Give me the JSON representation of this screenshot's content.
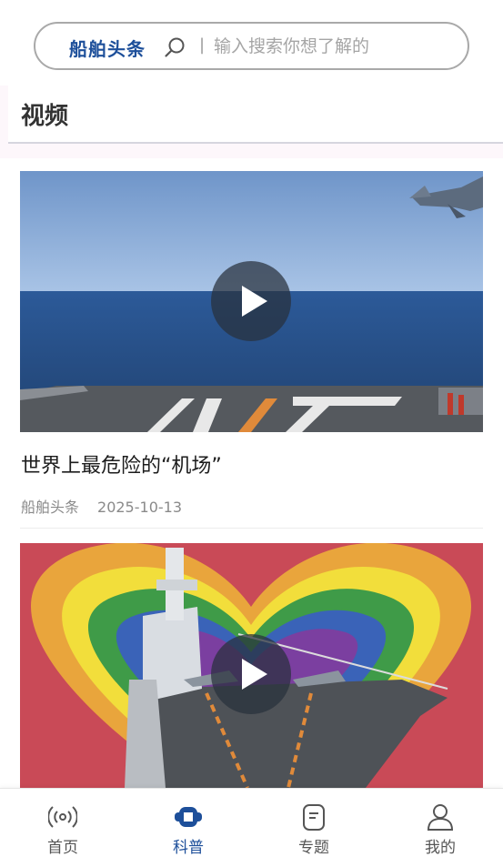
{
  "search": {
    "brand": "船舶头条",
    "separator": "|",
    "placeholder": "输入搜索你想了解的"
  },
  "section": {
    "title": "视频"
  },
  "videos": [
    {
      "title": "世界上最危险的“机场”",
      "source": "船舶头条",
      "date": "2025-10-13"
    },
    {
      "title": "",
      "source": "",
      "date": ""
    }
  ],
  "nav": {
    "active_index": 1,
    "active_color": "#1d4f9a",
    "items": [
      {
        "label": "首页",
        "icon": "broadcast-icon"
      },
      {
        "label": "科普",
        "icon": "science-icon"
      },
      {
        "label": "专题",
        "icon": "document-icon"
      },
      {
        "label": "我的",
        "icon": "user-icon"
      }
    ]
  },
  "colors": {
    "brand": "#1d4f9a",
    "sea": "#2f5b96",
    "sky": "#8fb3df"
  }
}
